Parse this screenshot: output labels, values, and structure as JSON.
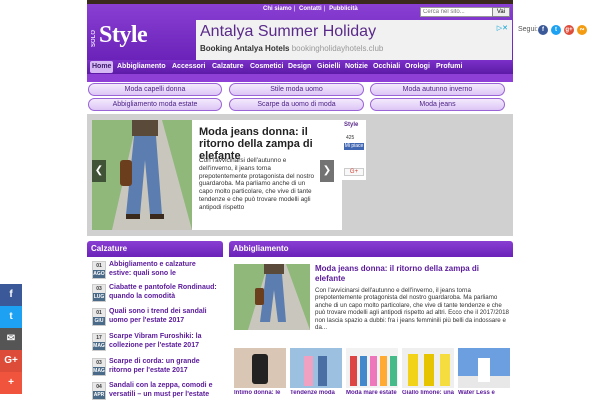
{
  "toplinks": [
    "Chi siamo",
    "Contatti",
    "Pubblicità"
  ],
  "search": {
    "placeholder": "Cerca nel sito...",
    "button": "Vai"
  },
  "logo": {
    "small": "SOLO",
    "big": "Style"
  },
  "ad": {
    "title": "Antalya Summer Holiday",
    "subtitle": "Booking Antalya Hotels",
    "domain": "bookingholidayhotels.club"
  },
  "follow": {
    "label": "Segui:",
    "icons": [
      "facebook-icon",
      "twitter-icon",
      "google-plus-icon",
      "rss-icon"
    ]
  },
  "nav": [
    "Home",
    "Abbigliamento",
    "Accessori",
    "Calzature",
    "Cosmetici",
    "Design",
    "Gioielli",
    "Notizie",
    "Occhiali",
    "Orologi",
    "Profumi"
  ],
  "pills": [
    "Moda capelli donna",
    "Stile moda uomo",
    "Moda autunno inverno",
    "Abbigliamento moda estate",
    "Scarpe da uomo di moda",
    "Moda jeans"
  ],
  "slider": {
    "title": "Moda jeans donna: il ritorno della zampa di elefante",
    "text": "Con l'avvicinarsi dell'autunno e dell'inverno, il jeans torna prepotentemente protagonista del nostro guardaroba. Ma parliamo anche di un capo molto particolare, che vive di tante tendenze e che può trovare modelli agli antipodi rispetto"
  },
  "fbbox": {
    "brand": "Style",
    "count": "425",
    "like": "Mi piace",
    "gplus": "G+"
  },
  "calzature": {
    "heading": "Calzature",
    "items": [
      {
        "day": "01",
        "month": "AGO",
        "text": "Abbigliamento e calzature estive: quali sono le"
      },
      {
        "day": "03",
        "month": "LUG",
        "text": "Ciabatte e pantofole Rondinaud: quando la comodità"
      },
      {
        "day": "01",
        "month": "GIU",
        "text": "Quali sono i trend dei sandali uomo per l'estate 2017"
      },
      {
        "day": "17",
        "month": "MAG",
        "text": "Scarpe Vibram Furoshiki: la collezione per l'estate 2017"
      },
      {
        "day": "03",
        "month": "MAG",
        "text": "Scarpe di corda: un grande ritorno per l'estate 2017"
      },
      {
        "day": "04",
        "month": "APR",
        "text": "Sandali con la zeppa, comodi e versatili – un must per l'estate"
      }
    ]
  },
  "abbigliamento": {
    "heading": "Abbigliamento",
    "title": "Moda jeans donna: il ritorno della zampa di elefante",
    "text": "Con l'avvicinarsi dell'autunno e dell'inverno, il jeans torna prepotentemente protagonista del nostro guardaroba. Ma parliamo anche di un capo molto particolare, che vive di tante tendenze e che può trovare modelli agli antipodi rispetto ad altri. Ecco che il 2017/2018 non lascia spazio a dubbi: fra i jeans femminili più belli da indossare e da...",
    "thumbs": [
      "Intimo donna: le",
      "Tendenze moda",
      "Moda mare estate",
      "Giallo limone: una",
      "Water Less e"
    ]
  },
  "share": [
    "facebook-icon",
    "twitter-icon",
    "email-icon",
    "google-plus-icon",
    "plus-icon"
  ]
}
